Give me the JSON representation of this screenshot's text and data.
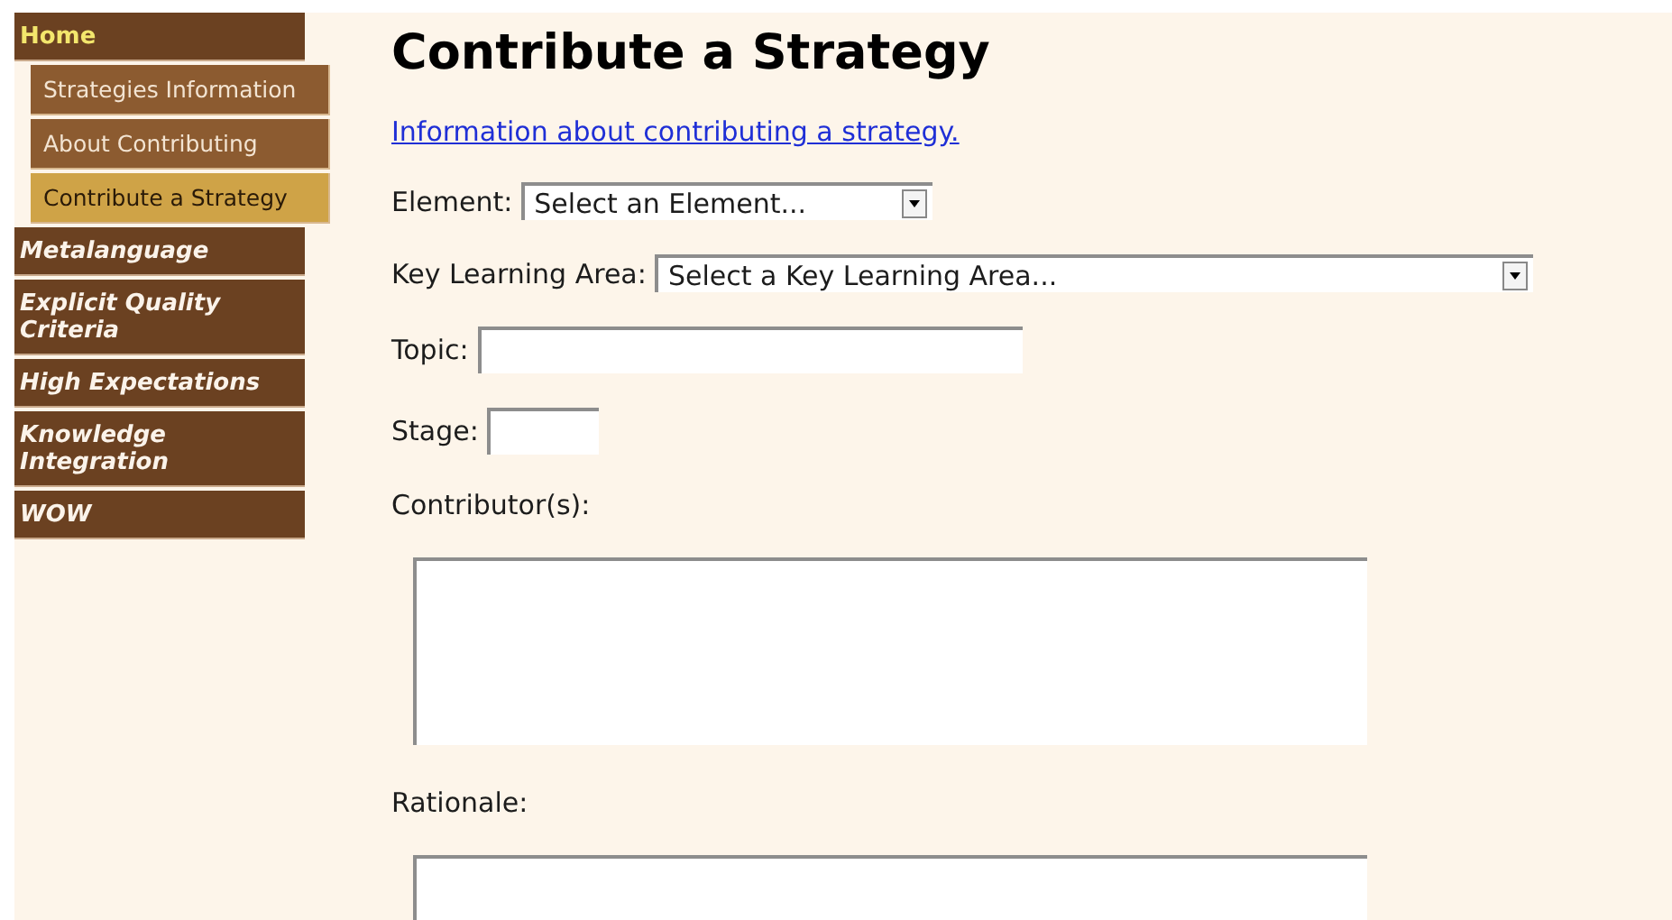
{
  "sidebar": {
    "items": [
      {
        "label": "Home",
        "selected": true,
        "children": [
          {
            "label": "Strategies Information",
            "selected": false
          },
          {
            "label": "About Contributing",
            "selected": false
          },
          {
            "label": "Contribute a Strategy",
            "selected": true
          }
        ]
      },
      {
        "label": "Metalanguage",
        "selected": false
      },
      {
        "label": "Explicit Quality Criteria",
        "selected": false
      },
      {
        "label": "High Expectations",
        "selected": false
      },
      {
        "label": "Knowledge Integration",
        "selected": false
      },
      {
        "label": "WOW",
        "selected": false
      }
    ]
  },
  "page": {
    "title": "Contribute a Strategy",
    "link": "Information about contributing a strategy.",
    "fields": [
      {
        "kind": "select",
        "label": "Element:",
        "value": "Select an Element..."
      },
      {
        "kind": "select",
        "label": "Key Learning Area:",
        "value": "Select a Key Learning Area..."
      },
      {
        "kind": "text",
        "label": "Topic:"
      },
      {
        "kind": "text",
        "label": "Stage:"
      },
      {
        "kind": "textarea",
        "label": "Contributor(s):"
      },
      {
        "kind": "textarea",
        "label": "Rationale:"
      }
    ]
  }
}
